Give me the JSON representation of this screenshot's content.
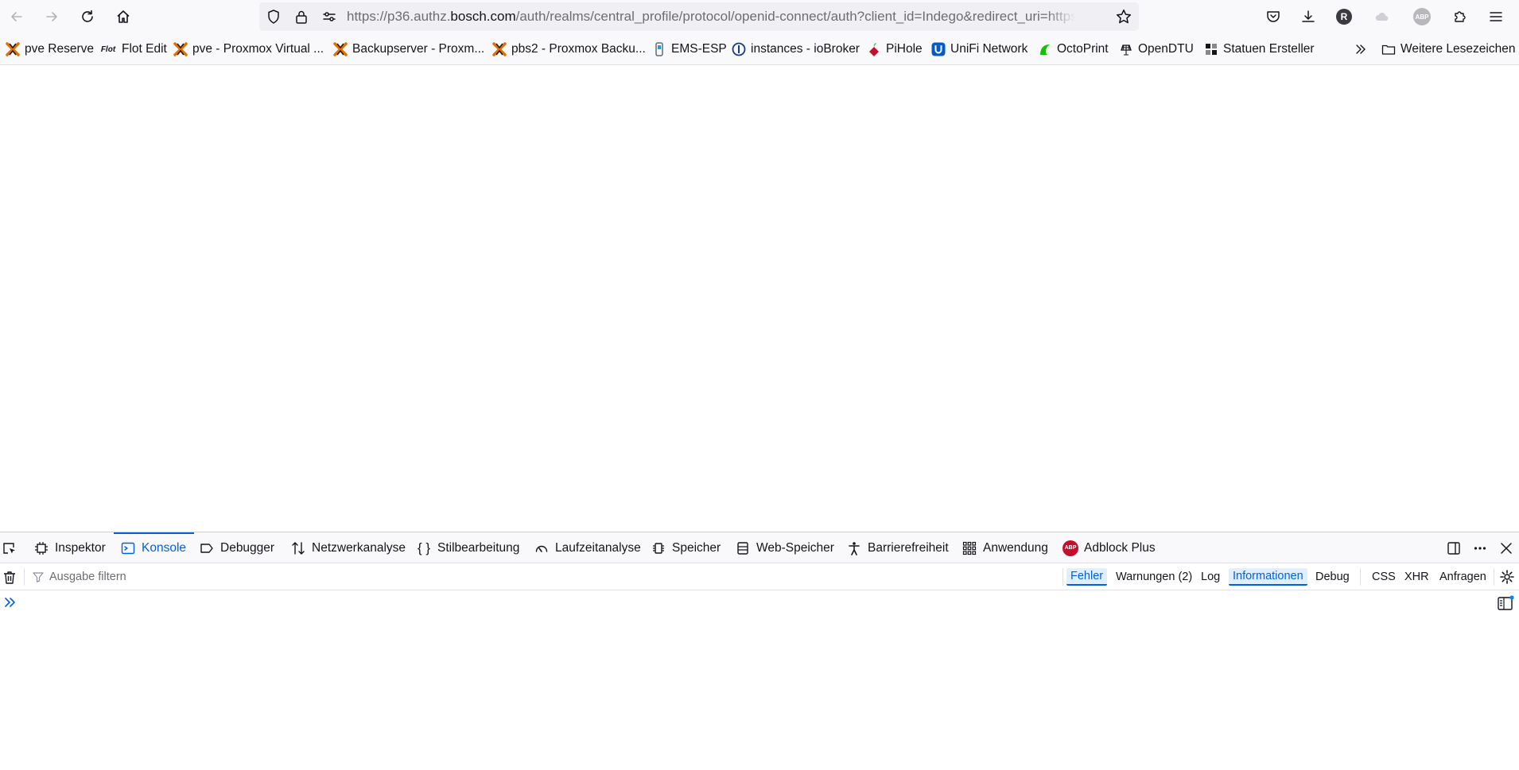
{
  "url": {
    "prefix": "https://p36.authz.",
    "domain": "bosch.com",
    "rest": "/auth/realms/central_profile/protocol/openid-connect/auth?client_id=Indego&redirect_uri=https://..."
  },
  "toolbar": {
    "profile_initial": "R",
    "abp_badge": "ABP"
  },
  "bookmarks": [
    {
      "label": "pve Reserve",
      "icon": "proxmox-icon"
    },
    {
      "label": "Flot Edit",
      "icon": "flot-icon"
    },
    {
      "label": "pve - Proxmox Virtual ...",
      "icon": "proxmox-icon"
    },
    {
      "label": "Backupserver - Proxm...",
      "icon": "proxmox-icon"
    },
    {
      "label": "pbs2 - Proxmox Backu...",
      "icon": "proxmox-icon"
    },
    {
      "label": "EMS-ESP",
      "icon": "ems-esp-icon"
    },
    {
      "label": "instances - ioBroker",
      "icon": "iobroker-icon"
    },
    {
      "label": "PiHole",
      "icon": "pihole-icon"
    },
    {
      "label": "UniFi Network",
      "icon": "unifi-icon"
    },
    {
      "label": "OctoPrint",
      "icon": "octoprint-icon"
    },
    {
      "label": "OpenDTU",
      "icon": "opendtu-icon"
    },
    {
      "label": "Statuen Ersteller",
      "icon": "statuen-icon"
    }
  ],
  "flot_icon_text": "Flot",
  "other_bookmarks": "Weitere Lesezeichen",
  "devtools": {
    "tabs": [
      {
        "label": "Inspektor",
        "icon": "inspector-icon"
      },
      {
        "label": "Konsole",
        "icon": "console-icon",
        "active": true
      },
      {
        "label": "Debugger",
        "icon": "debugger-icon"
      },
      {
        "label": "Netzwerkanalyse",
        "icon": "network-icon"
      },
      {
        "label": "Stilbearbeitung",
        "icon": "style-editor-icon"
      },
      {
        "label": "Laufzeitanalyse",
        "icon": "performance-icon"
      },
      {
        "label": "Speicher",
        "icon": "memory-icon"
      },
      {
        "label": "Web-Speicher",
        "icon": "storage-icon"
      },
      {
        "label": "Barrierefreiheit",
        "icon": "accessibility-icon"
      },
      {
        "label": "Anwendung",
        "icon": "application-icon"
      },
      {
        "label": "Adblock Plus",
        "icon": "adblock-plus-icon"
      }
    ],
    "filter_placeholder": "Ausgabe filtern",
    "levels": [
      {
        "label": "Fehler",
        "checked": true
      },
      {
        "label": "Warnungen (2)",
        "checked": false
      },
      {
        "label": "Log",
        "checked": false
      },
      {
        "label": "Informationen",
        "checked": true
      },
      {
        "label": "Debug",
        "checked": false
      }
    ],
    "types": [
      {
        "label": "CSS"
      },
      {
        "label": "XHR"
      },
      {
        "label": "Anfragen"
      }
    ],
    "abp_tab_badge": "ABP"
  },
  "colors": {
    "accent": "#0060df",
    "chrome_bg": "#f9f9fb",
    "urlbar_bg": "#f0f0f4",
    "proxmox_orange": "#e57000",
    "abp_red": "#c70d2c"
  }
}
